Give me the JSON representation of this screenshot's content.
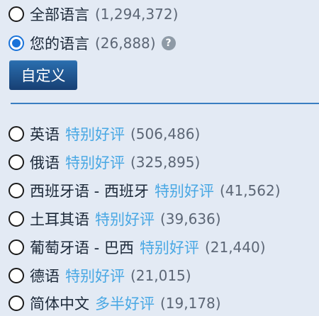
{
  "filters": {
    "all_languages": {
      "label": "全部语言",
      "count": "(1,294,372)"
    },
    "your_languages": {
      "label": "您的语言",
      "count": "(26,888)",
      "help_icon": "?"
    },
    "customize_button": "自定义"
  },
  "languages": [
    {
      "name": "英语",
      "review": "特别好评",
      "count": "(506,486)"
    },
    {
      "name": "俄语",
      "review": "特别好评",
      "count": "(325,895)"
    },
    {
      "name": "西班牙语 - 西班牙",
      "review": "特别好评",
      "count": "(41,562)"
    },
    {
      "name": "土耳其语",
      "review": "特别好评",
      "count": "(39,636)"
    },
    {
      "name": "葡萄牙语 - 巴西",
      "review": "特别好评",
      "count": "(21,440)"
    },
    {
      "name": "德语",
      "review": "特别好评",
      "count": "(21,015)"
    },
    {
      "name": "简体中文",
      "review": "多半好评",
      "count": "(19,178)"
    }
  ],
  "colors": {
    "background": "#e3eaf4",
    "review_link": "#49a8e4",
    "radio_selected": "#1a73d9",
    "button": "#1f5a94"
  }
}
